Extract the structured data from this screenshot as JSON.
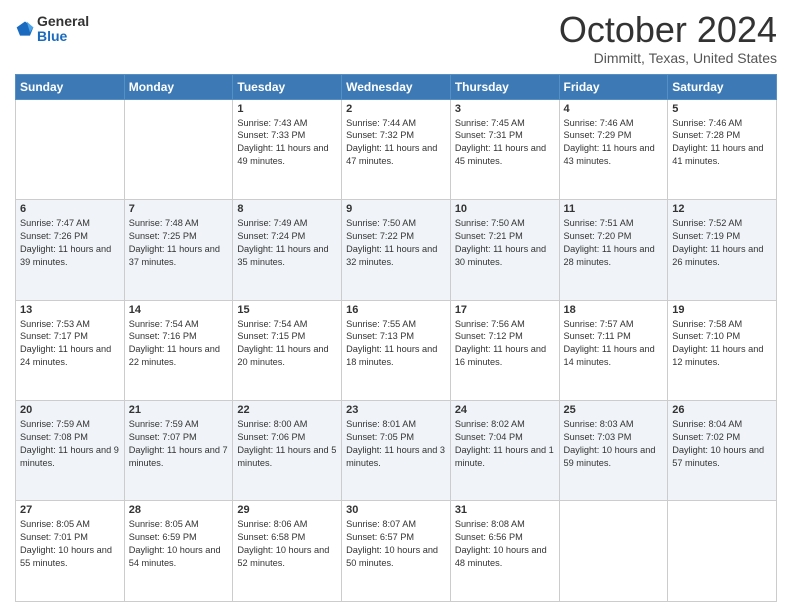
{
  "header": {
    "logo": {
      "general": "General",
      "blue": "Blue"
    },
    "title": "October 2024",
    "location": "Dimmitt, Texas, United States"
  },
  "weekdays": [
    "Sunday",
    "Monday",
    "Tuesday",
    "Wednesday",
    "Thursday",
    "Friday",
    "Saturday"
  ],
  "weeks": [
    [
      {
        "day": "",
        "info": ""
      },
      {
        "day": "",
        "info": ""
      },
      {
        "day": "1",
        "info": "Sunrise: 7:43 AM\nSunset: 7:33 PM\nDaylight: 11 hours and 49 minutes."
      },
      {
        "day": "2",
        "info": "Sunrise: 7:44 AM\nSunset: 7:32 PM\nDaylight: 11 hours and 47 minutes."
      },
      {
        "day": "3",
        "info": "Sunrise: 7:45 AM\nSunset: 7:31 PM\nDaylight: 11 hours and 45 minutes."
      },
      {
        "day": "4",
        "info": "Sunrise: 7:46 AM\nSunset: 7:29 PM\nDaylight: 11 hours and 43 minutes."
      },
      {
        "day": "5",
        "info": "Sunrise: 7:46 AM\nSunset: 7:28 PM\nDaylight: 11 hours and 41 minutes."
      }
    ],
    [
      {
        "day": "6",
        "info": "Sunrise: 7:47 AM\nSunset: 7:26 PM\nDaylight: 11 hours and 39 minutes."
      },
      {
        "day": "7",
        "info": "Sunrise: 7:48 AM\nSunset: 7:25 PM\nDaylight: 11 hours and 37 minutes."
      },
      {
        "day": "8",
        "info": "Sunrise: 7:49 AM\nSunset: 7:24 PM\nDaylight: 11 hours and 35 minutes."
      },
      {
        "day": "9",
        "info": "Sunrise: 7:50 AM\nSunset: 7:22 PM\nDaylight: 11 hours and 32 minutes."
      },
      {
        "day": "10",
        "info": "Sunrise: 7:50 AM\nSunset: 7:21 PM\nDaylight: 11 hours and 30 minutes."
      },
      {
        "day": "11",
        "info": "Sunrise: 7:51 AM\nSunset: 7:20 PM\nDaylight: 11 hours and 28 minutes."
      },
      {
        "day": "12",
        "info": "Sunrise: 7:52 AM\nSunset: 7:19 PM\nDaylight: 11 hours and 26 minutes."
      }
    ],
    [
      {
        "day": "13",
        "info": "Sunrise: 7:53 AM\nSunset: 7:17 PM\nDaylight: 11 hours and 24 minutes."
      },
      {
        "day": "14",
        "info": "Sunrise: 7:54 AM\nSunset: 7:16 PM\nDaylight: 11 hours and 22 minutes."
      },
      {
        "day": "15",
        "info": "Sunrise: 7:54 AM\nSunset: 7:15 PM\nDaylight: 11 hours and 20 minutes."
      },
      {
        "day": "16",
        "info": "Sunrise: 7:55 AM\nSunset: 7:13 PM\nDaylight: 11 hours and 18 minutes."
      },
      {
        "day": "17",
        "info": "Sunrise: 7:56 AM\nSunset: 7:12 PM\nDaylight: 11 hours and 16 minutes."
      },
      {
        "day": "18",
        "info": "Sunrise: 7:57 AM\nSunset: 7:11 PM\nDaylight: 11 hours and 14 minutes."
      },
      {
        "day": "19",
        "info": "Sunrise: 7:58 AM\nSunset: 7:10 PM\nDaylight: 11 hours and 12 minutes."
      }
    ],
    [
      {
        "day": "20",
        "info": "Sunrise: 7:59 AM\nSunset: 7:08 PM\nDaylight: 11 hours and 9 minutes."
      },
      {
        "day": "21",
        "info": "Sunrise: 7:59 AM\nSunset: 7:07 PM\nDaylight: 11 hours and 7 minutes."
      },
      {
        "day": "22",
        "info": "Sunrise: 8:00 AM\nSunset: 7:06 PM\nDaylight: 11 hours and 5 minutes."
      },
      {
        "day": "23",
        "info": "Sunrise: 8:01 AM\nSunset: 7:05 PM\nDaylight: 11 hours and 3 minutes."
      },
      {
        "day": "24",
        "info": "Sunrise: 8:02 AM\nSunset: 7:04 PM\nDaylight: 11 hours and 1 minute."
      },
      {
        "day": "25",
        "info": "Sunrise: 8:03 AM\nSunset: 7:03 PM\nDaylight: 10 hours and 59 minutes."
      },
      {
        "day": "26",
        "info": "Sunrise: 8:04 AM\nSunset: 7:02 PM\nDaylight: 10 hours and 57 minutes."
      }
    ],
    [
      {
        "day": "27",
        "info": "Sunrise: 8:05 AM\nSunset: 7:01 PM\nDaylight: 10 hours and 55 minutes."
      },
      {
        "day": "28",
        "info": "Sunrise: 8:05 AM\nSunset: 6:59 PM\nDaylight: 10 hours and 54 minutes."
      },
      {
        "day": "29",
        "info": "Sunrise: 8:06 AM\nSunset: 6:58 PM\nDaylight: 10 hours and 52 minutes."
      },
      {
        "day": "30",
        "info": "Sunrise: 8:07 AM\nSunset: 6:57 PM\nDaylight: 10 hours and 50 minutes."
      },
      {
        "day": "31",
        "info": "Sunrise: 8:08 AM\nSunset: 6:56 PM\nDaylight: 10 hours and 48 minutes."
      },
      {
        "day": "",
        "info": ""
      },
      {
        "day": "",
        "info": ""
      }
    ]
  ]
}
